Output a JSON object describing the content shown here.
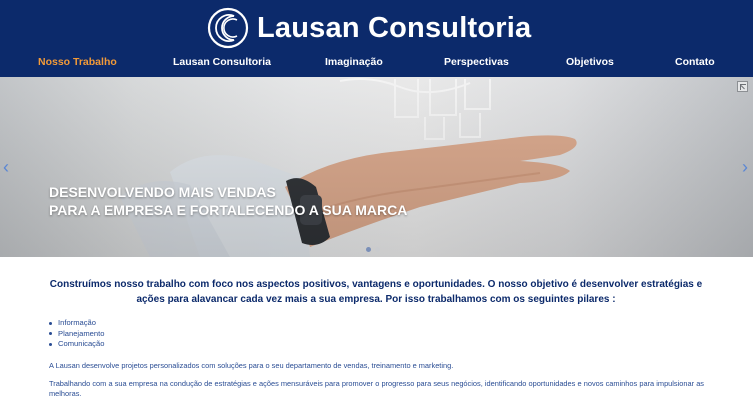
{
  "header": {
    "brand_name": "Lausan Consultoria",
    "logo_icon": "crescent-circle-logo-icon",
    "background_color": "#0c2a6b"
  },
  "nav": {
    "items": [
      {
        "label": "Nosso Trabalho",
        "active": true
      },
      {
        "label": "Lausan Consultoria",
        "active": false
      },
      {
        "label": "Imaginação",
        "active": false
      },
      {
        "label": "Perspectivas",
        "active": false
      },
      {
        "label": "Objetivos",
        "active": false
      },
      {
        "label": "Contato",
        "active": false
      }
    ],
    "active_color": "#f29a38"
  },
  "hero": {
    "caption_line1": "DESENVOLVENDO MAIS VENDAS",
    "caption_line2": "PARA A EMPRESA E FORTALECENDO A SUA MARCA",
    "prev_icon": "chevron-left-icon",
    "next_icon": "chevron-right-icon",
    "expand_icon": "fullscreen-icon",
    "image_subject": "open hand with rising bar chart",
    "slide_count": 2,
    "active_slide": 1
  },
  "content": {
    "intro": "Construímos nosso trabalho com foco nos aspectos positivos, vantagens e oportunidades. O nosso objetivo é desenvolver estratégias e ações para alavancar cada vez mais a sua empresa. Por isso trabalhamos com os seguintes pilares :",
    "pillars": [
      "Informação",
      "Planejamento",
      "Comunicação"
    ],
    "paragraph1": "A Lausan desenvolve projetos personalizados com soluções para o seu departamento de vendas, treinamento e marketing.",
    "paragraph2": "Trabalhando com a sua empresa na condução de estratégias e ações mensuráveis para promover o progresso para seus negócios, identificando oportunidades e novos caminhos para impulsionar as melhoras."
  }
}
